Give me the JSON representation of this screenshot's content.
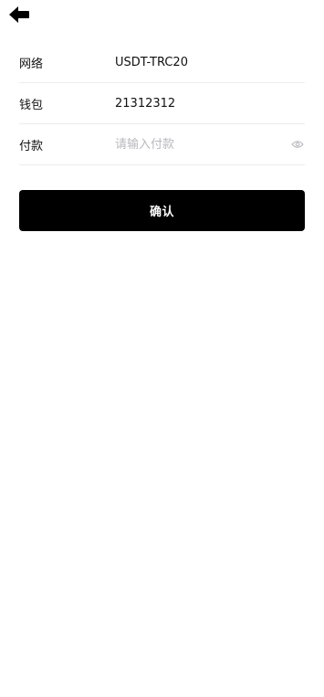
{
  "header": {
    "back_icon": "back-arrow-icon"
  },
  "form": {
    "network": {
      "label": "网络",
      "value": "USDT-TRC20"
    },
    "wallet": {
      "label": "钱包",
      "value": "21312312"
    },
    "payment": {
      "label": "付款",
      "placeholder": "请输入付款",
      "value": "",
      "toggle_icon": "eye-icon"
    }
  },
  "actions": {
    "confirm_label": "确认"
  },
  "colors": {
    "primary": "#000000",
    "placeholder": "#b8b8bd",
    "divider": "#ececec"
  }
}
